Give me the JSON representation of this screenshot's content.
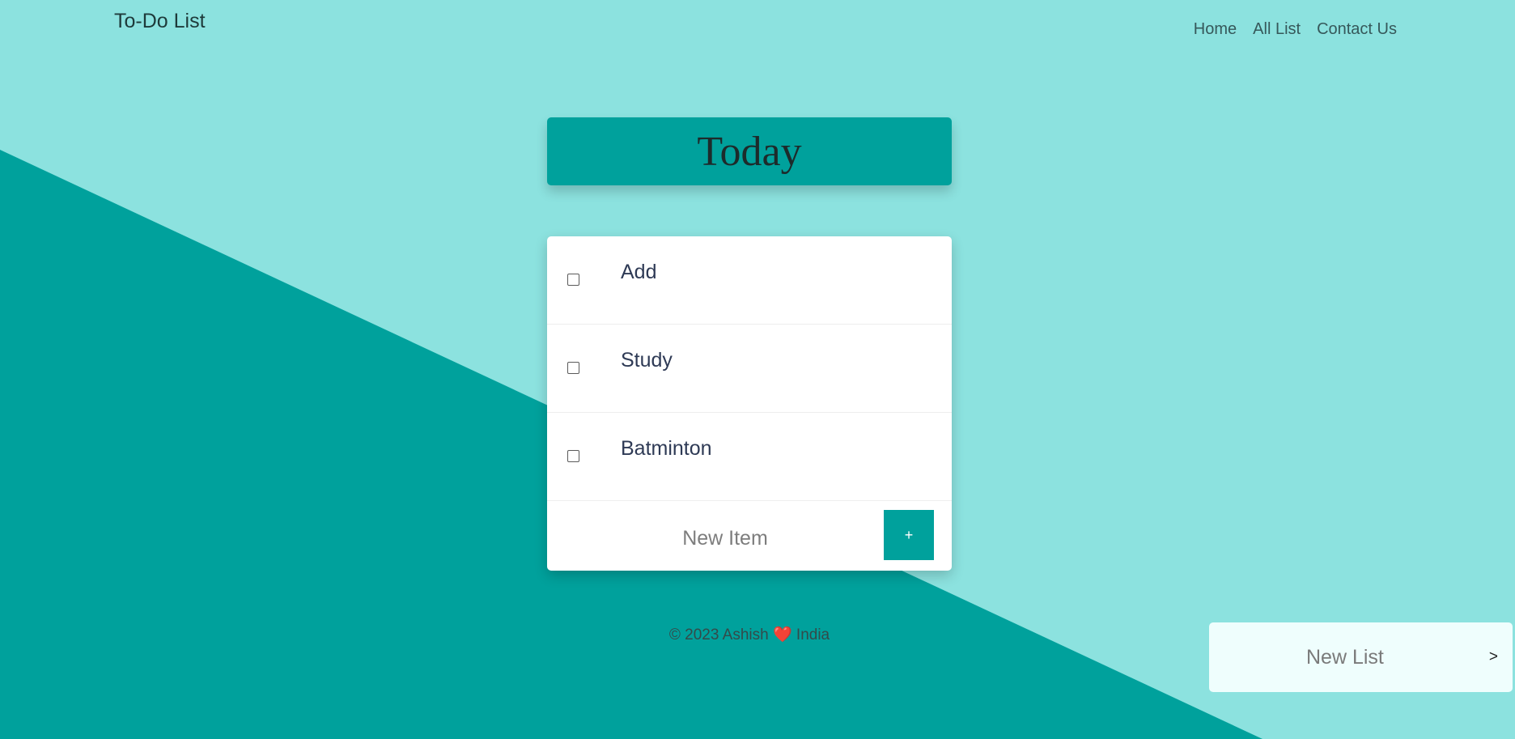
{
  "header": {
    "brand": "To-Do List",
    "nav": [
      "Home",
      "All List",
      "Contact Us"
    ]
  },
  "list": {
    "title": "Today",
    "items": [
      {
        "label": "Add",
        "checked": false
      },
      {
        "label": "Study",
        "checked": false
      },
      {
        "label": "Batminton",
        "checked": false
      }
    ],
    "new_item_placeholder": "New Item",
    "add_button_label": "+"
  },
  "footer": {
    "prefix": "© 2023 Ashish",
    "heart": "❤️",
    "suffix": "India"
  },
  "new_list": {
    "label": "New List",
    "arrow": ">"
  },
  "colors": {
    "background_light": "#8ce2df",
    "background_dark": "#00a19c",
    "accent": "#00a19c",
    "card": "#ffffff",
    "new_list_card": "#effefd"
  },
  "icons": {
    "checkbox": "checkbox-icon",
    "add": "plus-icon",
    "arrow": "chevron-right-icon",
    "heart": "heart-icon"
  }
}
